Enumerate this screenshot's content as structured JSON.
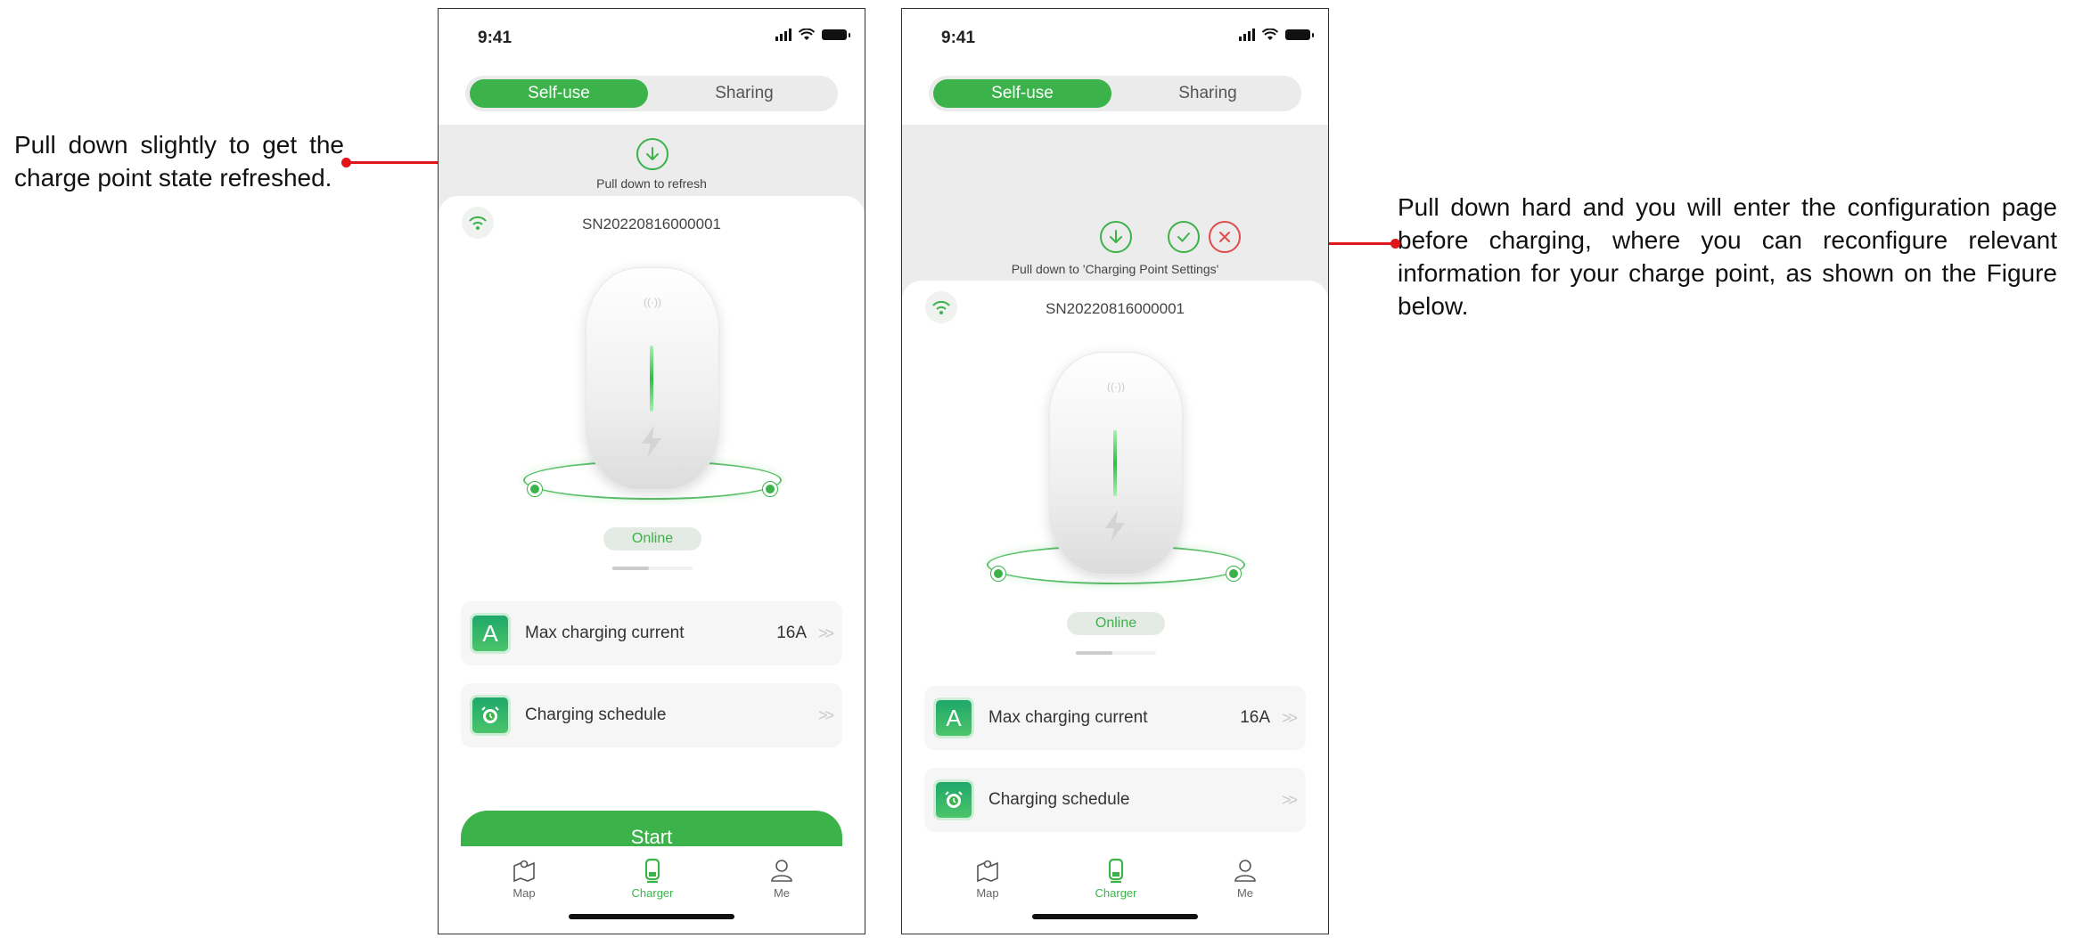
{
  "annotations": {
    "left": "Pull down slightly to get the charge point state refreshed.",
    "right": "Pull down hard and you will enter the configuration page before charging, where you can reconfigure relevant information for your charge point, as shown on the Figure below."
  },
  "colors": {
    "accent": "#3bb34a",
    "callout": "#e0161b",
    "cancel": "#e24b4b"
  },
  "phone1": {
    "time": "9:41",
    "tabs": {
      "selfuse": "Self-use",
      "sharing": "Sharing"
    },
    "pull_label": "Pull down to refresh",
    "sn": "SN20220816000001",
    "status": "Online",
    "max_current_label": "Max charging current",
    "max_current_value": "16A",
    "schedule_label": "Charging schedule",
    "start_label": "Start",
    "nav": {
      "map": "Map",
      "charger": "Charger",
      "me": "Me"
    }
  },
  "phone2": {
    "time": "9:41",
    "tabs": {
      "selfuse": "Self-use",
      "sharing": "Sharing"
    },
    "pull_label": "Pull down to 'Charging Point Settings'",
    "sn": "SN20220816000001",
    "status": "Online",
    "max_current_label": "Max charging current",
    "max_current_value": "16A",
    "schedule_label": "Charging schedule",
    "nav": {
      "map": "Map",
      "charger": "Charger",
      "me": "Me"
    }
  }
}
